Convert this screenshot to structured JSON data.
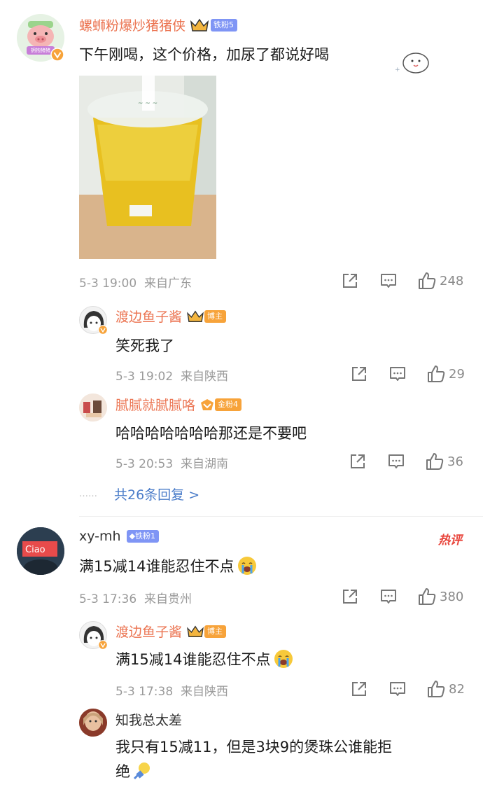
{
  "comments": [
    {
      "user": "螺蛳粉爆炒猪猪侠",
      "badge": "铁粉5",
      "avatar_tag": "拥抱猪猪",
      "text": "下午刚喝，这个价格，加尿了都说好喝",
      "meta": "5-3 19:00  来自广东",
      "likes": "248",
      "replies": [
        {
          "user": "渡边鱼子酱",
          "badge": "博主",
          "text": "笑死我了",
          "meta": "5-3 19:02  来自陕西",
          "likes": "29"
        },
        {
          "user": "腻腻就腻腻咯",
          "badge": "金粉4",
          "text": "哈哈哈哈哈哈哈那还是不要吧",
          "meta": "5-3 20:53  来自湖南",
          "likes": "36"
        }
      ],
      "more_replies": "共26条回复 >",
      "more_dots": "……"
    },
    {
      "user": "xy-mh",
      "badge": "铁粉1",
      "hot_tag": "热评",
      "text": "满15减14谁能忍住不点",
      "meta": "5-3 17:36  来自贵州",
      "likes": "380",
      "replies": [
        {
          "user": "渡边鱼子酱",
          "badge": "博主",
          "text": "满15减14谁能忍住不点",
          "meta": "5-3 17:38  来自陕西",
          "likes": "82"
        },
        {
          "user": "知我总太差",
          "text_line1": "我只有15减11，但是3块9的煲珠公谁能拒",
          "text_line2": "绝"
        }
      ]
    }
  ],
  "colors": {
    "username": "#eb7350",
    "badge_fan": "#7f95f5",
    "badge_blogger": "#f7a33a",
    "badge_gold": "#f7a33a",
    "hot": "#e8433a",
    "meta": "#9a9a9a"
  },
  "icons": [
    "share-icon",
    "comment-icon",
    "like-icon",
    "crown-icon",
    "verified-icon",
    "cry-emoji",
    "bulb-emoji"
  ]
}
